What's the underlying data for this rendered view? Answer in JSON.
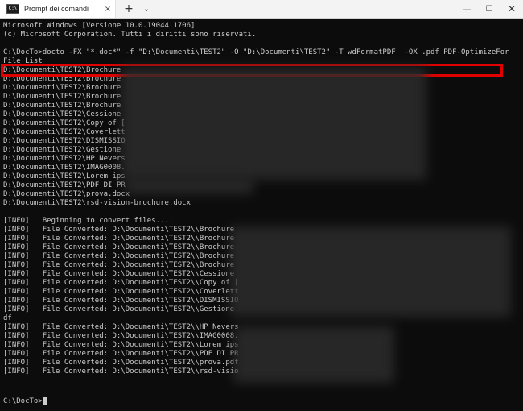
{
  "window": {
    "tab_title": "Prompt dei comandi",
    "tab_icon_text": "C:\\",
    "tab_close": "×",
    "new_tab": "+",
    "tab_dropdown": "⌄",
    "minimize": "—",
    "maximize": "☐",
    "close": "✕"
  },
  "console": {
    "lines": [
      "Microsoft Windows [Versione 10.0.19044.1706]",
      "(c) Microsoft Corporation. Tutti i diritti sono riservati.",
      "",
      "C:\\DocTo>docto -FX \"*.doc*\" -f \"D:\\Documenti\\TEST2\" -O \"D:\\Documenti\\TEST2\" -T wdFormatPDF  -OX .pdf PDF-OptimizeFor",
      "File List",
      "D:\\Documenti\\TEST2\\Brochure",
      "D:\\Documenti\\TEST2\\Brochure",
      "D:\\Documenti\\TEST2\\Brochure",
      "D:\\Documenti\\TEST2\\Brochure",
      "D:\\Documenti\\TEST2\\Brochure",
      "D:\\Documenti\\TEST2\\Cessione",
      "D:\\Documenti\\TEST2\\Copy of [",
      "D:\\Documenti\\TEST2\\Coverlett",
      "D:\\Documenti\\TEST2\\DISMISSIO",
      "D:\\Documenti\\TEST2\\Gestione",
      "D:\\Documenti\\TEST2\\HP Nevers",
      "D:\\Documenti\\TEST2\\IMAG0008.",
      "D:\\Documenti\\TEST2\\Lorem ips",
      "D:\\Documenti\\TEST2\\PDF DI PR",
      "D:\\Documenti\\TEST2\\prova.docx",
      "D:\\Documenti\\TEST2\\rsd-vision-brochure.docx",
      "",
      "[INFO]   Beginning to convert files....",
      "[INFO]   File Converted: D:\\Documenti\\TEST2\\\\Brochure",
      "[INFO]   File Converted: D:\\Documenti\\TEST2\\\\Brochure",
      "[INFO]   File Converted: D:\\Documenti\\TEST2\\\\Brochure",
      "[INFO]   File Converted: D:\\Documenti\\TEST2\\\\Brochure",
      "[INFO]   File Converted: D:\\Documenti\\TEST2\\\\Brochure",
      "[INFO]   File Converted: D:\\Documenti\\TEST2\\\\Cessione",
      "[INFO]   File Converted: D:\\Documenti\\TEST2\\\\Copy of [",
      "[INFO]   File Converted: D:\\Documenti\\TEST2\\\\Coverlett",
      "[INFO]   File Converted: D:\\Documenti\\TEST2\\\\DISMISSIO",
      "[INFO]   File Converted: D:\\Documenti\\TEST2\\\\Gestione",
      "df",
      "[INFO]   File Converted: D:\\Documenti\\TEST2\\\\HP Nevers",
      "[INFO]   File Converted: D:\\Documenti\\TEST2\\\\IMAG0008.",
      "[INFO]   File Converted: D:\\Documenti\\TEST2\\\\Lorem ips",
      "[INFO]   File Converted: D:\\Documenti\\TEST2\\\\PDF DI PR",
      "[INFO]   File Converted: D:\\Documenti\\TEST2\\\\prova.pdf",
      "[INFO]   File Converted: D:\\Documenti\\TEST2\\\\rsd-visio",
      "",
      "",
      "",
      "C:\\DocTo>"
    ]
  }
}
